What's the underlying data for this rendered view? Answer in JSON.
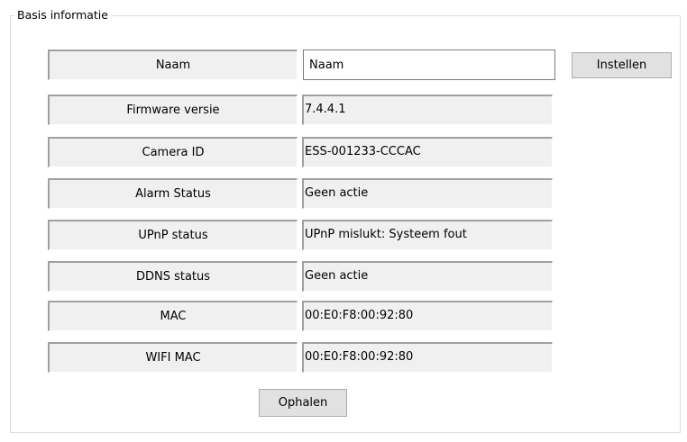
{
  "group": {
    "title": "Basis informatie"
  },
  "rows": [
    {
      "label": "Naam",
      "value": "Naam"
    },
    {
      "label": "Firmware versie",
      "value": "7.4.4.1"
    },
    {
      "label": "Camera ID",
      "value": "ESS-001233-CCCAC"
    },
    {
      "label": "Alarm Status",
      "value": "Geen actie"
    },
    {
      "label": "UPnP status",
      "value": "UPnP mislukt: Systeem fout"
    },
    {
      "label": "DDNS status",
      "value": "Geen actie"
    },
    {
      "label": "MAC",
      "value": "00:E0:F8:00:92:80"
    },
    {
      "label": "WIFI MAC",
      "value": "00:E0:F8:00:92:80"
    }
  ],
  "buttons": {
    "set_label": "Instellen",
    "fetch_label": "Ophalen"
  }
}
